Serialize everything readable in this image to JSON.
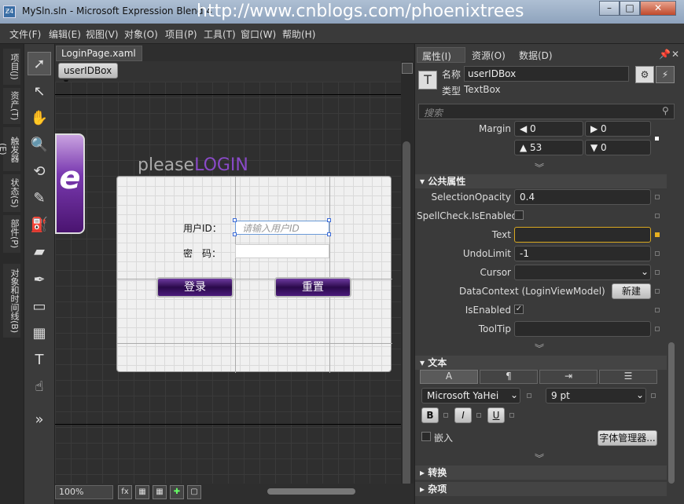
{
  "window": {
    "title": "MySln.sln - Microsoft Expression Blend 4",
    "watermark": "http://www.cnblogs.com/phoenixtrees",
    "app_icon": "Ƶ4",
    "controls": [
      "–",
      "□",
      "✕"
    ]
  },
  "menu": [
    "文件(F)",
    "编辑(E)",
    "视图(V)",
    "对象(O)",
    "项目(P)",
    "工具(T)",
    "窗口(W)",
    "帮助(H)"
  ],
  "left_tabs": [
    "项目(J)",
    "资产(T)",
    "触发器(E)",
    "状态(S)",
    "部件(P)",
    "对象和时间线(B)"
  ],
  "document": {
    "tab_label": "LoginPage.xaml",
    "tab_close": "×",
    "breadcrumb": "userIDBox ▾"
  },
  "canvas": {
    "title_prefix": "please",
    "title_accent": "LOGIN",
    "userid_label": "用户ID：",
    "userid_placeholder": "请输入用户ID",
    "password_label": "密　码：",
    "login_button": "登录",
    "reset_button": "重置",
    "purple_glyph": "e"
  },
  "status": {
    "zoom": "100%",
    "fx_label": "fx"
  },
  "properties": {
    "tabs": [
      "属性(I)",
      "资源(O)",
      "数据(D)"
    ],
    "name_label": "名称",
    "name_value": "userIDBox",
    "type_label": "类型",
    "type_value": "TextBox",
    "search_placeholder": "搜索",
    "margin_label": "Margin",
    "margin": {
      "left": "0",
      "right": "0",
      "top": "53",
      "bottom": "0"
    },
    "common_section": "公共属性",
    "selection_opacity_label": "SelectionOpacity",
    "selection_opacity_value": "0.4",
    "spellcheck_label": "SpellCheck.IsEnabled",
    "text_label": "Text",
    "text_value": "",
    "undolimit_label": "UndoLimit",
    "undolimit_value": "-1",
    "cursor_label": "Cursor",
    "cursor_value": "",
    "datacontext_label": "DataContext",
    "datacontext_value": "(LoginViewModel)",
    "new_button": "新建",
    "isenabled_label": "IsEnabled",
    "tooltip_label": "ToolTip",
    "text_section": "文本",
    "font_family": "Microsoft YaHei",
    "font_size": "9 pt",
    "bold": "B",
    "italic": "I",
    "underline": "U",
    "embed_label": "嵌入",
    "font_manager_button": "字体管理器...",
    "transform_section": "转换",
    "misc_section": "杂项"
  }
}
